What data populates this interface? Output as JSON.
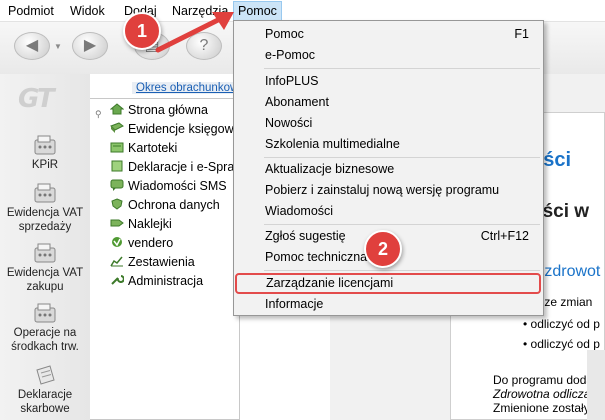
{
  "menubar": {
    "items": [
      "Podmiot",
      "Widok",
      "Dodaj",
      "Narzędzia",
      "Pomoc"
    ],
    "active": "Pomoc"
  },
  "toolbar": {
    "buttons": [
      "back-icon",
      "forward-icon",
      "print-icon",
      "help-icon"
    ]
  },
  "sidebar": {
    "logo": "GT",
    "items": [
      {
        "label": "KPiR",
        "icon": "calculator-icon"
      },
      {
        "label": "Ewidencja VAT sprzedaży",
        "icon": "calculator-icon"
      },
      {
        "label": "Ewidencja VAT zakupu",
        "icon": "calculator-icon"
      },
      {
        "label": "Operacje na środkach trw.",
        "icon": "calculator-icon"
      },
      {
        "label": "Deklaracje skarbowe",
        "icon": "document-icon"
      }
    ]
  },
  "tree": {
    "period_link": "Okres obrachunkowy",
    "items": [
      "Strona główna",
      "Ewidencje księgowe",
      "Kartoteki",
      "Deklaracje i e-Sprawozdania",
      "Wiadomości SMS",
      "Ochrona danych",
      "Naklejki",
      "vendero",
      "Zestawienia",
      "Administracja"
    ]
  },
  "content": {
    "heading1": "ości",
    "heading2": "ości w",
    "subheading": "a zdrowot",
    "line1": "tu ze zmian",
    "bullets": [
      "odliczyć od p",
      "odliczyć od p"
    ],
    "para1": "Do programu dodan",
    "para2": "Zdrowotna odliczana",
    "para3": "Zmienione zostały n"
  },
  "help_menu": {
    "items": [
      {
        "label": "Pomoc",
        "shortcut": "F1"
      },
      {
        "label": "e-Pomoc",
        "shortcut": ""
      },
      {
        "label": "InfoPLUS",
        "shortcut": ""
      },
      {
        "label": "Abonament",
        "shortcut": ""
      },
      {
        "label": "Nowości",
        "shortcut": ""
      },
      {
        "label": "Szkolenia multimedialne",
        "shortcut": ""
      },
      {
        "label": "Aktualizacje biznesowe",
        "shortcut": ""
      },
      {
        "label": "Pobierz i zainstaluj nową wersję programu",
        "shortcut": ""
      },
      {
        "label": "Wiadomości",
        "shortcut": ""
      },
      {
        "label": "Zgłoś sugestię",
        "shortcut": "Ctrl+F12"
      },
      {
        "label": "Pomoc techniczna",
        "shortcut": ""
      },
      {
        "label": "Zarządzanie licencjami",
        "shortcut": ""
      },
      {
        "label": "Informacje",
        "shortcut": ""
      }
    ],
    "highlighted": "Zarządzanie licencjami"
  },
  "annotations": {
    "step1": "1",
    "step2": "2",
    "color": "#e0403d"
  }
}
